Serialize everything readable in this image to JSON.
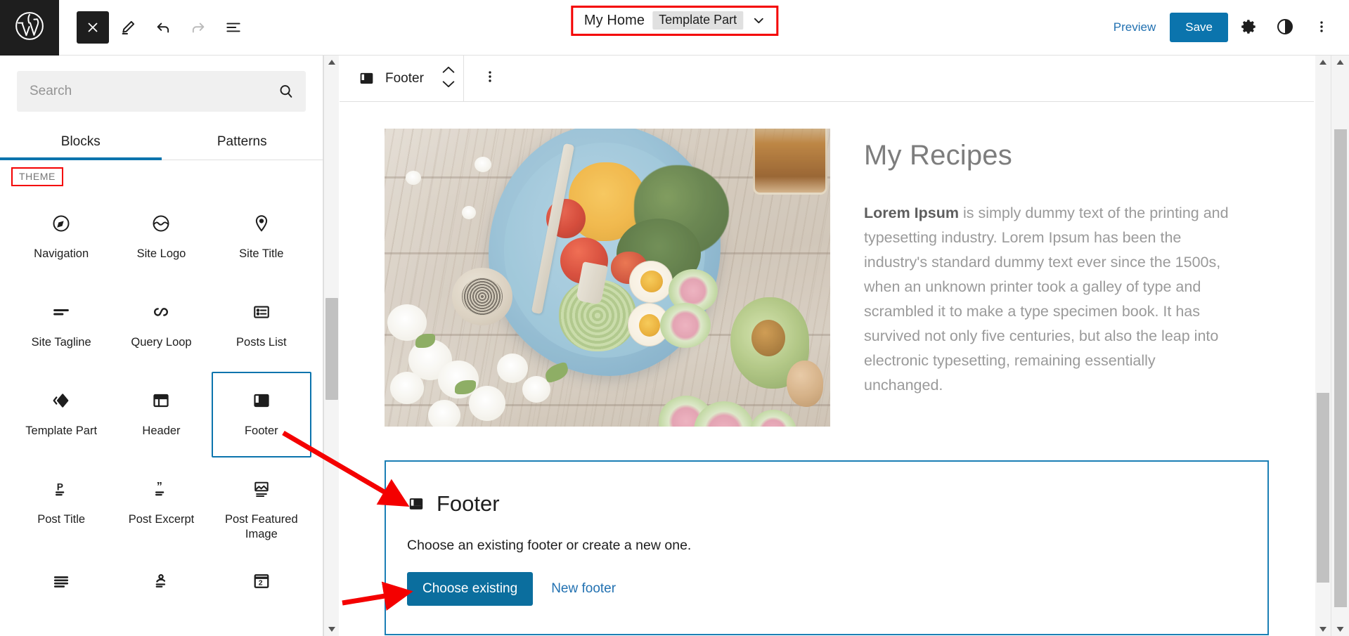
{
  "header": {
    "logo_icon": "wordpress-logo-icon",
    "tools": [
      {
        "name": "close-editor-button",
        "icon": "close-x-icon",
        "state": "dark"
      },
      {
        "name": "edit-mode-button",
        "icon": "pencil-icon",
        "state": "normal"
      },
      {
        "name": "undo-button",
        "icon": "undo-arrow-icon",
        "state": "normal"
      },
      {
        "name": "redo-button",
        "icon": "redo-arrow-icon",
        "state": "disabled"
      },
      {
        "name": "list-view-button",
        "icon": "list-view-icon",
        "state": "normal"
      }
    ],
    "document_title": "My Home",
    "document_badge": "Template Part",
    "dropdown_icon": "chevron-down-icon",
    "preview_label": "Preview",
    "save_label": "Save",
    "settings_icon": "gear-icon",
    "styles_icon": "contrast-half-circle-icon",
    "more_icon": "three-dots-vertical-icon",
    "save_color": "#0b74ad",
    "link_color": "#2271b1"
  },
  "sidebar": {
    "search": {
      "placeholder": "Search",
      "value": "",
      "icon": "search-magnifier-icon"
    },
    "tabs": [
      {
        "label": "Blocks",
        "active": true
      },
      {
        "label": "Patterns",
        "active": false
      }
    ],
    "section_label": "THEME",
    "section_label_highlight_color": "#f40000",
    "blocks": [
      {
        "label": "Navigation",
        "icon": "navigation-compass-icon",
        "selected": false
      },
      {
        "label": "Site Logo",
        "icon": "site-logo-circle-icon",
        "selected": false
      },
      {
        "label": "Site Title",
        "icon": "map-pin-icon",
        "selected": false
      },
      {
        "label": "Site Tagline",
        "icon": "tagline-lines-icon",
        "selected": false
      },
      {
        "label": "Query Loop",
        "icon": "query-loop-infinity-icon",
        "selected": false
      },
      {
        "label": "Posts List",
        "icon": "posts-list-icon",
        "selected": false
      },
      {
        "label": "Template Part",
        "icon": "template-part-diamond-icon",
        "selected": false
      },
      {
        "label": "Header",
        "icon": "header-layout-icon",
        "selected": false
      },
      {
        "label": "Footer",
        "icon": "footer-layout-icon",
        "selected": true
      },
      {
        "label": "Post Title",
        "icon": "post-title-p-icon",
        "selected": false
      },
      {
        "label": "Post Excerpt",
        "icon": "post-excerpt-quote-icon",
        "selected": false
      },
      {
        "label": "Post Featured Image",
        "icon": "post-featured-image-icon",
        "selected": false
      },
      {
        "label": "",
        "icon": "post-content-lines-icon",
        "selected": false
      },
      {
        "label": "",
        "icon": "post-author-icon",
        "selected": false
      },
      {
        "label": "",
        "icon": "post-date-calendar-icon",
        "selected": false
      }
    ],
    "selected_border_color": "#0b74ad"
  },
  "block_toolbar": {
    "block_icon": "footer-layout-icon",
    "block_label": "Footer",
    "movers_icon": "up-down-chevrons-icon",
    "options_icon": "three-dots-vertical-icon"
  },
  "canvas": {
    "image": {
      "name": "food-photo",
      "alt": "Plate of salad with boiled eggs, tomatoes, avocado and radish on a wooden table"
    },
    "heading": "My Recipes",
    "paragraph_bold": "Lorem Ipsum",
    "paragraph_rest": " is simply dummy text of the printing and typesetting industry. Lorem Ipsum has been the industry's standard dummy text ever since the 1500s, when an unknown printer took a galley of type and scrambled it to make a type specimen book. It has survived not only five centuries, but also the leap into electronic typesetting, remaining essentially unchanged.",
    "footer_placeholder": {
      "icon": "footer-layout-icon",
      "title": "Footer",
      "description": "Choose an existing footer or create a new one.",
      "primary_button": "Choose existing",
      "secondary_link": "New footer",
      "border_color": "#1b7fb5",
      "primary_color": "#0b6e9e"
    }
  },
  "annotations": {
    "color": "#f40000",
    "arrows": [
      {
        "name": "arrow-footer-block-to-placeholder"
      },
      {
        "name": "arrow-to-choose-existing"
      }
    ],
    "boxes": [
      {
        "name": "highlight-document-title"
      },
      {
        "name": "highlight-theme-label"
      }
    ]
  }
}
